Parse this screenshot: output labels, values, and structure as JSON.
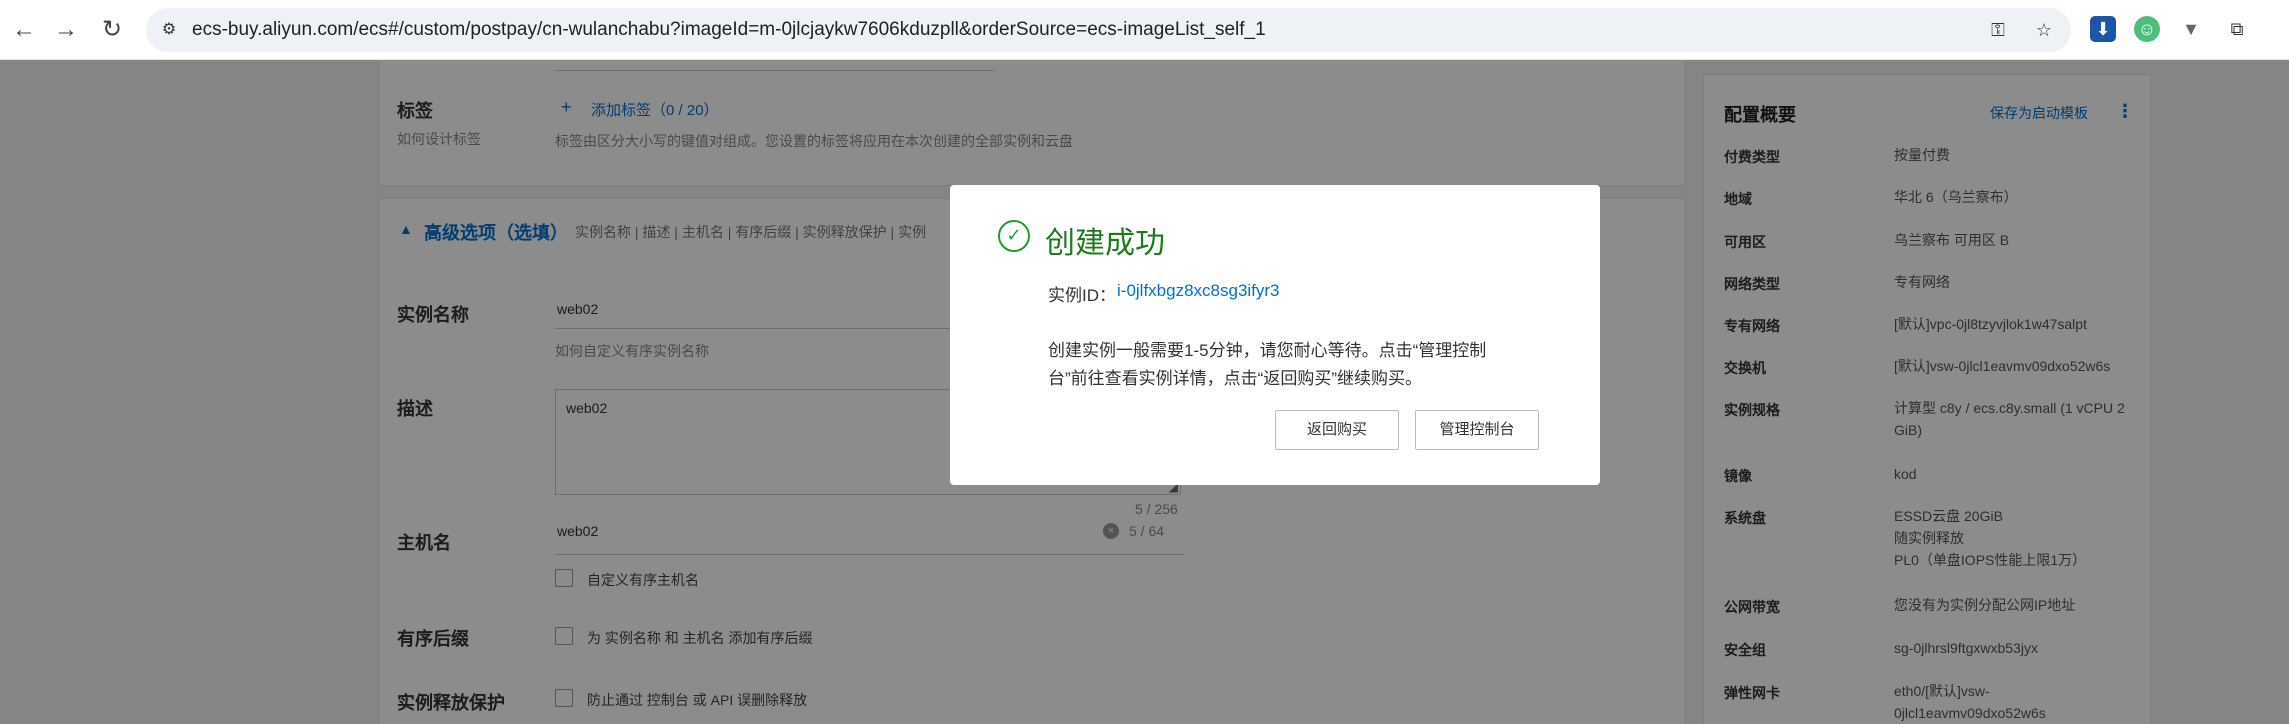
{
  "browser": {
    "url": "ecs-buy.aliyun.com/ecs#/custom/postpay/cn-wulanchabu?imageId=m-0jlcjaykw7606kduzpll&orderSource=ecs-imageList_self_1",
    "nav_icons": [
      "back-arrow-icon",
      "forward-arrow-icon",
      "reload-icon"
    ],
    "extension_icons": [
      "download-icon",
      "user-extension-icon",
      "filter-extension-icon",
      "puzzle-icon"
    ]
  },
  "form": {
    "tags_label": "标签",
    "tags_help": "如何设计标签",
    "add_tag": "添加标签（0 / 20）",
    "tags_desc": "标签由区分大小写的键值对组成。您设置的标签将应用在本次创建的全部实例和云盘",
    "advanced_title": "高级选项（选填）",
    "advanced_summary": "实例名称 | 描述 | 主机名 | 有序后缀 | 实例释放保护 | 实例",
    "instance_name_label": "实例名称",
    "instance_name_value": "web02",
    "instance_name_help": "如何自定义有序实例名称",
    "desc_label": "描述",
    "desc_value": "web02",
    "desc_count": "5 / 256",
    "hostname_label": "主机名",
    "hostname_value": "web02",
    "hostname_count": "5 / 64",
    "custom_hostname": "自定义有序主机名",
    "suffix_label": "有序后缀",
    "suffix_option": "为 实例名称 和 主机名 添加有序后缀",
    "protect_label": "实例释放保护",
    "protect_option": "防止通过 控制台 或 API 误删除释放"
  },
  "summary": {
    "title": "配置概要",
    "save_template": "保存为启动模板",
    "more_icon": "⋮",
    "rows": [
      {
        "key": "付费类型",
        "value": "按量付费"
      },
      {
        "key": "地域",
        "value": "华北 6（乌兰察布）"
      },
      {
        "key": "可用区",
        "value": "乌兰察布 可用区 B"
      },
      {
        "key": "网络类型",
        "value": "专有网络"
      },
      {
        "key": "专有网络",
        "value": "[默认]vpc-0jl8tzyvjlok1w47salpt"
      },
      {
        "key": "交换机",
        "value": "[默认]vsw-0jlcl1eavmv09dxo52w6s"
      },
      {
        "key": "实例规格",
        "value": "计算型 c8y / ecs.c8y.small (1 vCPU 2",
        "value2": "GiB)"
      },
      {
        "key": "镜像",
        "value": "kod"
      },
      {
        "key": "系统盘",
        "value": "ESSD云盘 20GiB",
        "value2": "随实例释放",
        "value3": "PL0（单盘IOPS性能上限1万）"
      },
      {
        "key": "公网带宽",
        "value": "您没有为实例分配公网IP地址"
      },
      {
        "key": "安全组",
        "value": "sg-0jlhrsl9ftgxwxb53jyx"
      },
      {
        "key": "弹性网卡",
        "value": "eth0/[默认]vsw-",
        "value2": "0jlcl1eavmv09dxo52w6s"
      }
    ]
  },
  "modal": {
    "title": "创建成功",
    "id_label": "实例ID：",
    "id_value": "i-0jlfxbgz8xc8sg3ifyr3",
    "message": "创建实例一般需要1-5分钟，请您耐心等待。点击“管理控制台”前往查看实例详情，点击“返回购买”继续购买。",
    "back_button": "返回购买",
    "console_button": "管理控制台"
  },
  "colors": {
    "success": "#1f9b35",
    "link": "#0070cc"
  }
}
